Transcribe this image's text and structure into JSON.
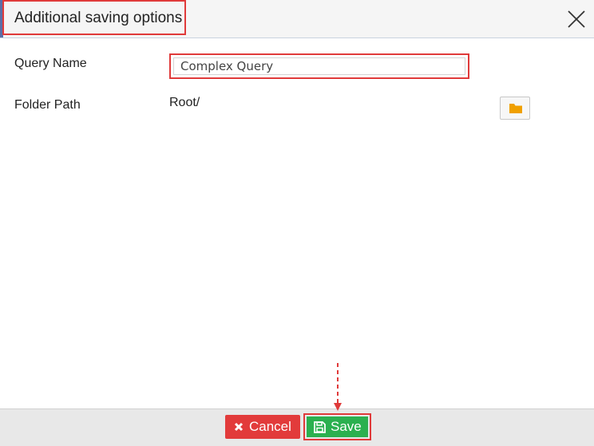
{
  "dialog": {
    "title": "Additional saving options",
    "close_icon": "close-icon"
  },
  "form": {
    "query_name_label": "Query Name",
    "query_name_value": "Complex Query",
    "folder_path_label": "Folder Path",
    "folder_path_value": "Root/",
    "folder_browse_icon": "folder-icon"
  },
  "footer": {
    "cancel_label": "Cancel",
    "cancel_icon": "x-icon",
    "save_label": "Save",
    "save_icon": "floppy-disk-icon"
  },
  "colors": {
    "highlight": "#e03a3a",
    "cancel": "#e23b3b",
    "save": "#2bb04f",
    "folder": "#f0a000",
    "header_accent": "#5b6fa8"
  }
}
